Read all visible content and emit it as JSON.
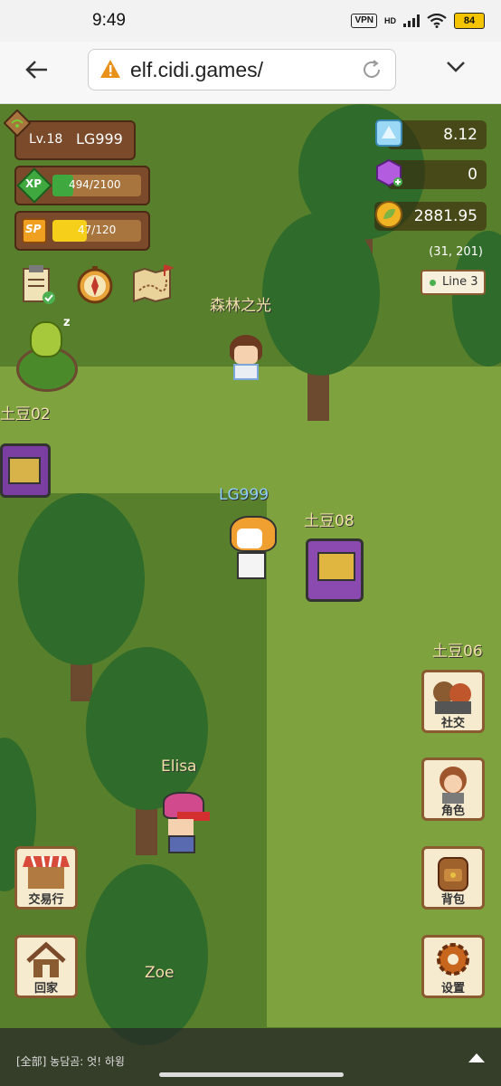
{
  "status_bar": {
    "time": "9:49",
    "vpn": "VPN",
    "hd": "HD",
    "battery": "84"
  },
  "browser": {
    "url": "elf.cidi.games/"
  },
  "player": {
    "level": "Lv.18",
    "name": "LG999",
    "xp_label": "XP",
    "xp": "494/2100",
    "xp_fraction": 0.235,
    "sp_label": "SP",
    "sp": "47/120",
    "sp_fraction": 0.39
  },
  "resources": {
    "crystal": "8.12",
    "gem": "0",
    "gold": "2881.95"
  },
  "coords": "(31, 201)",
  "line": "Line 3",
  "npcs": {
    "forest_light": "森林之光",
    "potato02": "土豆02",
    "lg999": "LG999",
    "potato08": "土豆08",
    "potato06": "土豆06",
    "elisa": "Elisa",
    "zoe": "Zoe"
  },
  "side_buttons": {
    "social": "社交",
    "character": "角色",
    "backpack": "背包",
    "trade": "交易行",
    "home": "回家",
    "settings": "设置"
  },
  "chat": {
    "message": "[全部] 농담곰: 엇! 하윙"
  },
  "icons": {
    "quest": "quest-scroll-icon",
    "compass": "compass-icon",
    "map": "map-icon",
    "pet": "sleeping-pet-icon"
  }
}
